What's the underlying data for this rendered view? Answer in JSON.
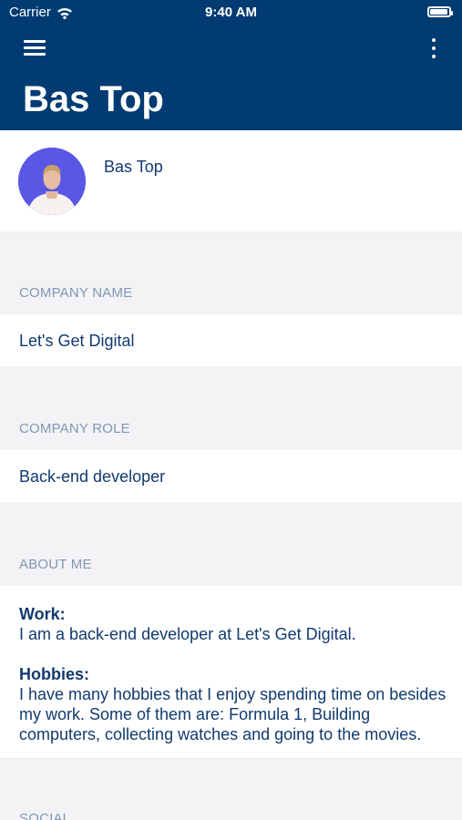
{
  "status": {
    "carrier": "Carrier",
    "time": "9:40 AM",
    "battery_level": 0.95
  },
  "header": {
    "title": "Bas Top"
  },
  "profile": {
    "name": "Bas Top"
  },
  "company_name": {
    "label": "COMPANY NAME",
    "value": "Let's Get Digital"
  },
  "company_role": {
    "label": "COMPANY ROLE",
    "value": "Back-end developer"
  },
  "about": {
    "label": "ABOUT ME",
    "work_label": "Work:",
    "work_text": "I am a back-end developer at Let's Get Digital.",
    "hobbies_label": "Hobbies:",
    "hobbies_text": "I have many hobbies that I enjoy spending time on besides my work. Some of them are: Formula 1, Building computers, collecting watches and going to the movies."
  },
  "social": {
    "label": "SOCIAL"
  },
  "icons": [
    "menu-icon",
    "more-vertical-icon",
    "wifi-icon",
    "battery-icon"
  ],
  "colors": {
    "header": "#003b72",
    "avatar_bg": "#5a57e6",
    "text": "#123a6e",
    "label": "#7f96b5",
    "background": "#f3f3f5"
  }
}
